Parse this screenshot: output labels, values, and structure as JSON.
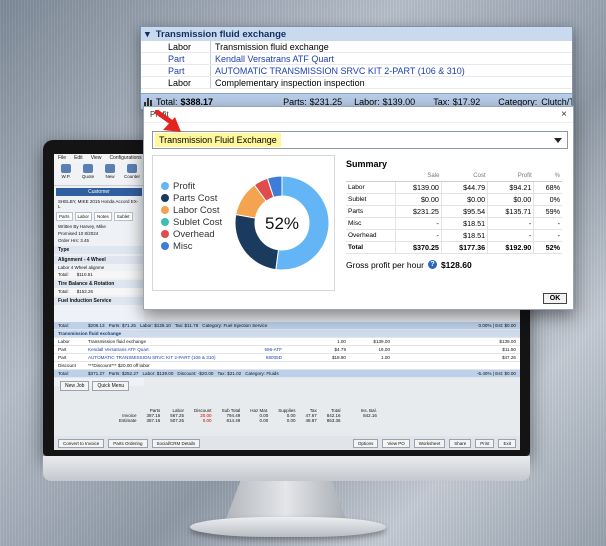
{
  "transmission": {
    "title": "Transmission fluid exchange",
    "lines": [
      {
        "type": "Labor",
        "desc": "Transmission fluid exchange",
        "blue": false
      },
      {
        "type": "Part",
        "desc": "Kendall Versatrans ATF Quart",
        "blue": true
      },
      {
        "type": "Part",
        "desc": "AUTOMATIC TRANSMISSION SRVC KIT 2-PART (106 & 310)",
        "blue": true
      },
      {
        "type": "Labor",
        "desc": "Complementary inspection inspection",
        "blue": false
      }
    ],
    "total_label": "Total:",
    "total": "$388.17",
    "parts_label": "Parts:",
    "parts": "$231.25",
    "labor_label": "Labor:",
    "labor": "$139.00",
    "tax_label": "Tax:",
    "tax": "$17.92",
    "category_label": "Category:",
    "category": "Clutch/Transm"
  },
  "profit": {
    "title": "Profit",
    "close": "×",
    "selected_job": "Transmission Fluid Exchange",
    "center_label": "52%",
    "legend": [
      {
        "label": "Profit",
        "color": "#64b5f6"
      },
      {
        "label": "Parts Cost",
        "color": "#1a3b5d"
      },
      {
        "label": "Labor Cost",
        "color": "#f4a350"
      },
      {
        "label": "Sublet Cost",
        "color": "#3dbfb0"
      },
      {
        "label": "Overhead",
        "color": "#e04c4c"
      },
      {
        "label": "Misc",
        "color": "#3b7dd8"
      }
    ],
    "chart_data": {
      "type": "pie",
      "categories": [
        "Profit",
        "Parts Cost",
        "Labor Cost",
        "Sublet Cost",
        "Overhead",
        "Misc"
      ],
      "values": [
        192.9,
        95.54,
        44.79,
        0.0,
        18.51,
        18.51
      ]
    },
    "summary_title": "Summary",
    "headers": [
      "",
      "Sale",
      "Cost",
      "Profit",
      "%"
    ],
    "rows": [
      [
        "Labor",
        "$139.00",
        "$44.79",
        "$94.21",
        "68%"
      ],
      [
        "Sublet",
        "$0.00",
        "$0.00",
        "$0.00",
        "0%"
      ],
      [
        "Parts",
        "$231.25",
        "$95.54",
        "$135.71",
        "59%"
      ],
      [
        "Misc",
        "-",
        "$18.51",
        "-",
        "-"
      ],
      [
        "Overhead",
        "-",
        "$18.51",
        "-",
        "-"
      ]
    ],
    "total_row": [
      "Total",
      "$370.25",
      "$177.36",
      "$192.90",
      "52%"
    ],
    "gross_label": "Gross profit per hour",
    "gross_value": "$128.60",
    "ok": "OK"
  },
  "screen": {
    "menu": [
      "File",
      "Edit",
      "View",
      "Configurations"
    ],
    "tools": [
      "W.P.",
      "Quote",
      "New",
      "Counter"
    ],
    "customer_tab": "Customer",
    "customer_line": "SHELBY, MIKE  2015 Honda Accord EX-L",
    "mini_tabs": [
      "Parts",
      "Labor",
      "Notes",
      "Sublet"
    ],
    "writer": "Written By   Harvey, Mike",
    "promised": "Promised   10 8/2024",
    "order_hrs": "Order Hrs:   3.45",
    "type_col": "Type",
    "sections": [
      {
        "title": "Alignment - 4 Wheel",
        "line": "Labor      4 Wheel alignme",
        "total": "$110.51"
      },
      {
        "title": "Tire Balance & Rotation",
        "line": "",
        "total": "$152.26"
      },
      {
        "title": "Fuel Induction Service",
        "line": "",
        "total": "$208.13"
      }
    ],
    "fuel_total_row": {
      "total": "$208.13",
      "parts": "Parts: $71.25",
      "labor": "Labor: $125.10",
      "tax": "Tax: $11.78",
      "cat": "Category: Fuel Injection Service",
      "pct": "0.00% | Est: $0.00"
    },
    "job_title": "Transmission fluid exchange",
    "job_rows": [
      {
        "type": "Labor",
        "desc": "Transmission fluid exchange",
        "code": "",
        "qty": "1.00",
        "price": "$139.00",
        "ext": "$139.00"
      },
      {
        "type": "Part",
        "desc": "Kendall Versatrans ATF Quart",
        "code": "596-ATF",
        "qty": "$4.79",
        "price": "16.00",
        "ext": "$11.50"
      },
      {
        "type": "Part",
        "desc": "AUTOMATIC TRANSMISSION SRVC KIT 2-PART (106 & 310)",
        "code": "68005D",
        "qty": "$18.90",
        "price": "1.00",
        "ext": "$47.26"
      },
      {
        "type": "Discount",
        "desc": "***Discount*** $20.00 off labor",
        "code": "",
        "qty": "",
        "price": "",
        "ext": ""
      }
    ],
    "job_total": {
      "total": "$371.27",
      "parts": "Parts: $252.27",
      "labor": "Labor: $139.00",
      "disc": "Discount: -$20.00",
      "tax": "Tax: $21.02",
      "cat": "Category: Fluids",
      "pct": "-5.40% | Est: $0.00"
    },
    "new_job": "New Job",
    "quick_menu": "Quick Menu",
    "summary_headers": [
      "Parts",
      "Labor",
      "Discount",
      "Sub Total",
      "Haz Mat.",
      "Supplies",
      "Tax",
      "Total",
      "",
      "Ins. Bal."
    ],
    "summary_rows": [
      [
        "Invoice",
        "387.16",
        "567.25",
        "20.00",
        "794.49",
        "0.00",
        "0.00",
        "47.67",
        "842.16",
        "",
        "842.16"
      ],
      [
        "Estimate",
        "387.16",
        "507.25",
        "0.00",
        "814.49",
        "0.00",
        "0.00",
        "48.87",
        "863.36",
        "",
        ""
      ]
    ],
    "bottom_buttons": [
      "Convert to Invoice",
      "Parts Ordering",
      "Social/CRM Details"
    ],
    "bottom_right": [
      "Options",
      "View PO",
      "Worksheet",
      "Share",
      "Print",
      "Exit"
    ]
  }
}
